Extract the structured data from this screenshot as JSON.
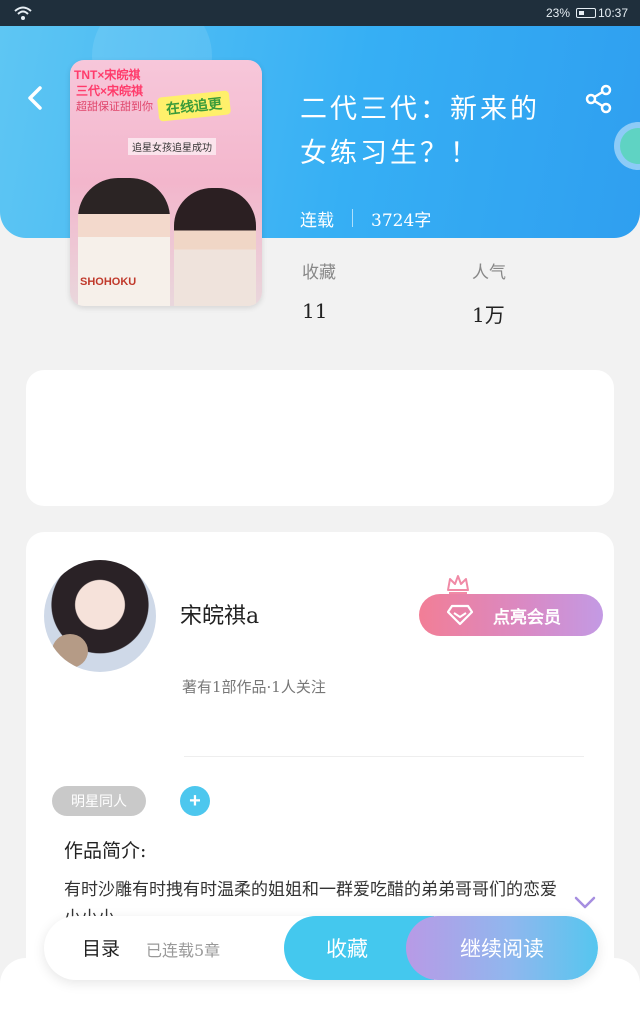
{
  "status_bar": {
    "battery_percent": "23%",
    "time": "10:37"
  },
  "book": {
    "title_line1": "二代三代：新来的",
    "title_line2": "女练习生？！",
    "serial_status": "连载",
    "word_count": "3724字"
  },
  "cover": {
    "tag1": "TNT×宋皖祺",
    "tag2": "三代×宋皖祺",
    "tag3": "超甜保证甜到你",
    "banner": "在线追更",
    "sub": "追星女孩追星成功",
    "jersey": "SHOHOKU"
  },
  "stats": {
    "favorites_label": "收藏",
    "favorites_value": "11",
    "popularity_label": "人气",
    "popularity_value": "1万"
  },
  "author": {
    "name": "宋皖祺a",
    "summary": "著有1部作品·1人关注",
    "vip_button": "点亮会员"
  },
  "tags": {
    "chip": "明星同人",
    "add": "+"
  },
  "intro": {
    "label": "作品简介:",
    "text": "有时沙雕有时拽有时温柔的姐姐和一群爱吃醋的弟弟哥哥们的恋爱小小小…"
  },
  "bottom_bar": {
    "toc_label": "目录",
    "toc_status": "已连载5章",
    "favorite_button": "收藏",
    "continue_button": "继续阅读"
  },
  "colors": {
    "header_blue": "#36aff4",
    "accent_cyan": "#44c8ee",
    "vip_pink": "#f27e96",
    "vip_purple": "#c39ae4"
  }
}
